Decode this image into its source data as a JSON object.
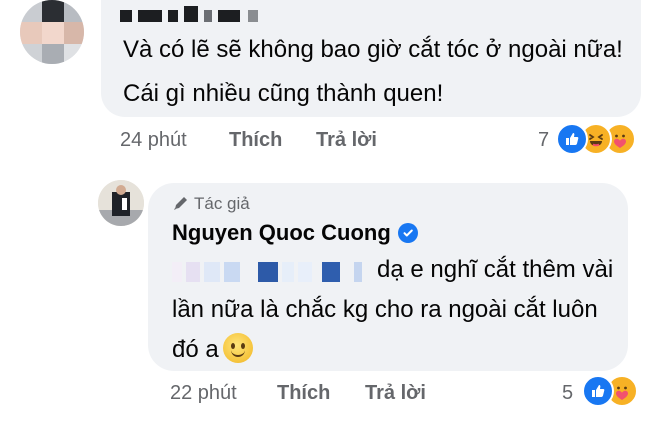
{
  "comment1": {
    "author_redacted": true,
    "text": "Và có lẽ sẽ không bao giờ cắt tóc ở ngoài nữa! Cái gì nhiều cũng thành quen!",
    "time": "24 phút",
    "like_label": "Thích",
    "reply_label": "Trả lời",
    "reaction_count": "7",
    "reactions": [
      "like-icon",
      "haha-icon",
      "care-icon"
    ]
  },
  "reply": {
    "author_badge": "Tác giả",
    "author_name": "Nguyen Quoc Cuong",
    "verified": true,
    "mention_redacted": true,
    "text": "dạ e nghĩ cắt thêm vài lần nữa là chắc kg cho ra ngoài cắt luôn đó a",
    "emoji": "slightly-smiling-face",
    "time": "22 phút",
    "like_label": "Thích",
    "reply_label": "Trả lời",
    "reaction_count": "5",
    "reactions": [
      "like-icon",
      "care-icon"
    ]
  },
  "colors": {
    "bubble": "#f0f2f5",
    "meta_text": "#65676b",
    "like_blue": "#1877f2",
    "emoji_yellow": "#f7b125"
  }
}
